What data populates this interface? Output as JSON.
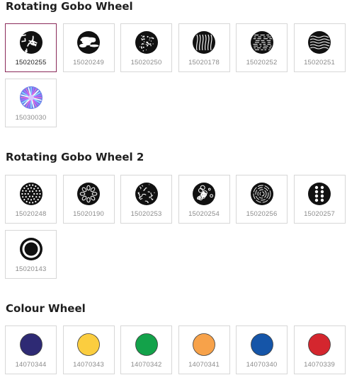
{
  "sections": [
    {
      "title": "Rotating Gobo Wheel",
      "items": [
        {
          "code": "15020255",
          "icon": "gobo-shards-icon",
          "selected": true
        },
        {
          "code": "15020249",
          "icon": "gobo-clouds-icon",
          "selected": false
        },
        {
          "code": "15020250",
          "icon": "gobo-stars-icon",
          "selected": false
        },
        {
          "code": "15020178",
          "icon": "gobo-flames-icon",
          "selected": false
        },
        {
          "code": "15020252",
          "icon": "gobo-dashes-icon",
          "selected": false
        },
        {
          "code": "15020251",
          "icon": "gobo-waves-icon",
          "selected": false
        },
        {
          "code": "15030030",
          "icon": "gobo-prism-icon",
          "selected": false
        }
      ]
    },
    {
      "title": "Rotating Gobo Wheel 2",
      "items": [
        {
          "code": "15020248",
          "icon": "gobo-dot-burst-icon",
          "selected": false
        },
        {
          "code": "15020190",
          "icon": "gobo-petal-ring-icon",
          "selected": false
        },
        {
          "code": "15020253",
          "icon": "gobo-cracked-glass-icon",
          "selected": false
        },
        {
          "code": "15020254",
          "icon": "gobo-bubbles-icon",
          "selected": false
        },
        {
          "code": "15020256",
          "icon": "gobo-rose-icon",
          "selected": false
        },
        {
          "code": "15020257",
          "icon": "gobo-dot-matrix-icon",
          "selected": false
        },
        {
          "code": "15020143",
          "icon": "gobo-ring-icon",
          "selected": false
        }
      ]
    },
    {
      "title": "Colour Wheel",
      "items": [
        {
          "code": "14070344",
          "icon": "color-swatch-icon",
          "color": "#2e2a74",
          "selected": false
        },
        {
          "code": "14070343",
          "icon": "color-swatch-icon",
          "color": "#fbcd3f",
          "selected": false
        },
        {
          "code": "14070342",
          "icon": "color-swatch-icon",
          "color": "#13a24a",
          "selected": false
        },
        {
          "code": "14070341",
          "icon": "color-swatch-icon",
          "color": "#f7a24a",
          "selected": false
        },
        {
          "code": "14070340",
          "icon": "color-swatch-icon",
          "color": "#1555a8",
          "selected": false
        },
        {
          "code": "14070339",
          "icon": "color-swatch-icon",
          "color": "#d4262e",
          "selected": false
        }
      ]
    }
  ],
  "colors": {
    "selected_border": "#8a2a5a",
    "tile_border": "#d7d7d7",
    "code_text": "#8b8b8b",
    "title_text": "#1f1f1f"
  }
}
